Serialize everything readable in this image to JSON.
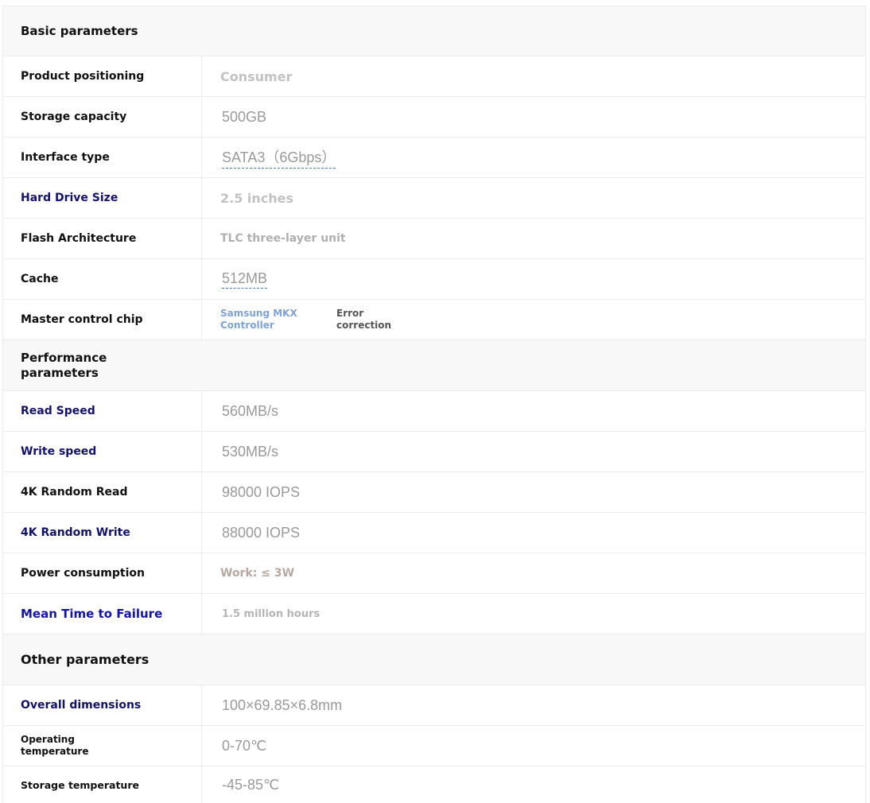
{
  "sections": [
    {
      "title": "Basic parameters",
      "rows": [
        {
          "label": "Product positioning",
          "value": "Consumer"
        },
        {
          "label": "Storage capacity",
          "value": "500GB"
        },
        {
          "label": "Interface type",
          "value": "SATA3（6Gbps）"
        },
        {
          "label": "Hard Drive Size",
          "value": "2.5 inches"
        },
        {
          "label": "Flash Architecture",
          "value": "TLC three-layer unit"
        },
        {
          "label": "Cache",
          "value": "512MB"
        },
        {
          "label": "Master control chip",
          "value": "Samsung MKX Controller",
          "extra": "Error correction"
        }
      ]
    },
    {
      "title": "Performance parameters",
      "rows": [
        {
          "label": "Read Speed",
          "value": "560MB/s"
        },
        {
          "label": "Write speed",
          "value": "530MB/s"
        },
        {
          "label": "4K Random Read",
          "value": "98000 IOPS"
        },
        {
          "label": "4K Random Write",
          "value": "88000 IOPS"
        },
        {
          "label": "Power consumption",
          "value": "Work: ≤ 3W"
        },
        {
          "label": "Mean Time to Failure",
          "value": "1.5 million hours"
        }
      ]
    },
    {
      "title": "Other parameters",
      "rows": [
        {
          "label": "Overall dimensions",
          "value": "100×69.85×6.8mm"
        },
        {
          "label": "Operating temperature",
          "value": "0-70℃"
        },
        {
          "label": "Storage temperature",
          "value": "-45-85℃"
        }
      ]
    }
  ],
  "colors": {
    "label_dark": "#111111",
    "label_navy": "#13126b",
    "label_blue": "#1414a8",
    "value_gray": "#9a9a9a",
    "value_light": "#c2c2c2",
    "link_blue": "#7fa3d8",
    "power_taupe": "#b8a8a0",
    "section_bg": "#f8f8f8"
  }
}
